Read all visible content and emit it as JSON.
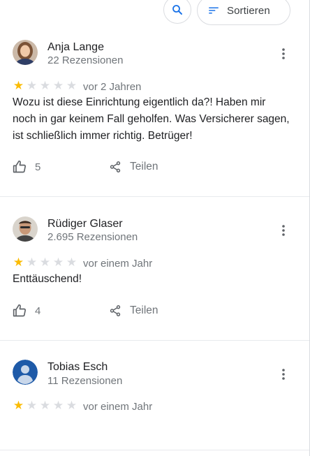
{
  "toolbar": {
    "search_icon": "search-icon",
    "sort_label": "Sortieren"
  },
  "rating_colors": {
    "filled": "#fbbc04",
    "empty": "#dadce0"
  },
  "reviews": [
    {
      "name": "Anja Lange",
      "review_count": "22 Rezensionen",
      "stars": 1,
      "max_stars": 5,
      "date": "vor 2 Jahren",
      "text": "Wozu ist diese Einrichtung eigentlich da?! Haben mir noch in gar keinem Fall geholfen. Was Versicherer sagen, ist schließlich immer richtig. Betrüger!",
      "likes": "5",
      "share_label": "Teilen"
    },
    {
      "name": "Rüdiger Glaser",
      "review_count": "2.695 Rezensionen",
      "stars": 1,
      "max_stars": 5,
      "date": "vor einem Jahr",
      "text": "Enttäuschend!",
      "likes": "4",
      "share_label": "Teilen"
    },
    {
      "name": "Tobias Esch",
      "review_count": "11 Rezensionen",
      "stars": 1,
      "max_stars": 5,
      "date": "vor einem Jahr"
    }
  ]
}
